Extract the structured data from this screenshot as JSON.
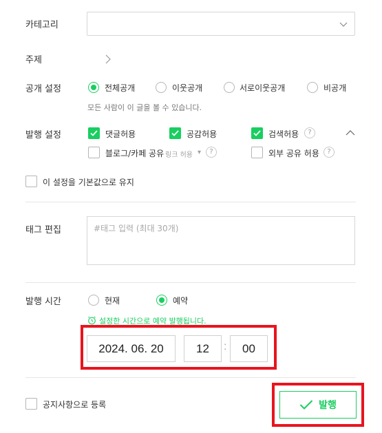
{
  "category": {
    "label": "카테고리",
    "value": ""
  },
  "subject": {
    "label": "주제"
  },
  "visibility": {
    "label": "공개 설정",
    "options": [
      "전체공개",
      "이웃공개",
      "서로이웃공개",
      "비공개"
    ],
    "selected": "전체공개",
    "hint": "모든 사람이 이 글을 볼 수 있습니다."
  },
  "publish_settings": {
    "label": "발행 설정",
    "allow_comments": {
      "label": "댓글허용",
      "checked": true
    },
    "allow_likes": {
      "label": "공감허용",
      "checked": true
    },
    "allow_search": {
      "label": "검색허용",
      "checked": true
    },
    "blog_cafe_share": {
      "label": "블로그/카페 공유",
      "sub": "링크 허용",
      "checked": false
    },
    "external_share": {
      "label": "외부 공유 허용",
      "checked": false
    },
    "help": "?"
  },
  "default_keep": {
    "label": "이 설정을 기본값으로 유지",
    "checked": false
  },
  "tags": {
    "label": "태그 편집",
    "placeholder": "#태그 입력 (최대 30개)"
  },
  "publish_time": {
    "label": "발행 시간",
    "options": [
      "현재",
      "예약"
    ],
    "selected": "예약",
    "notice": "설정한 시간으로 예약 발행됩니다.",
    "date": "2024. 06. 20",
    "hour": "12",
    "separator": ":",
    "minute": "00"
  },
  "notice_register": {
    "label": "공지사항으로 등록",
    "checked": false
  },
  "publish_button": {
    "label": "발행"
  },
  "colors": {
    "accent": "#19ce60",
    "highlight": "#e8141e"
  }
}
